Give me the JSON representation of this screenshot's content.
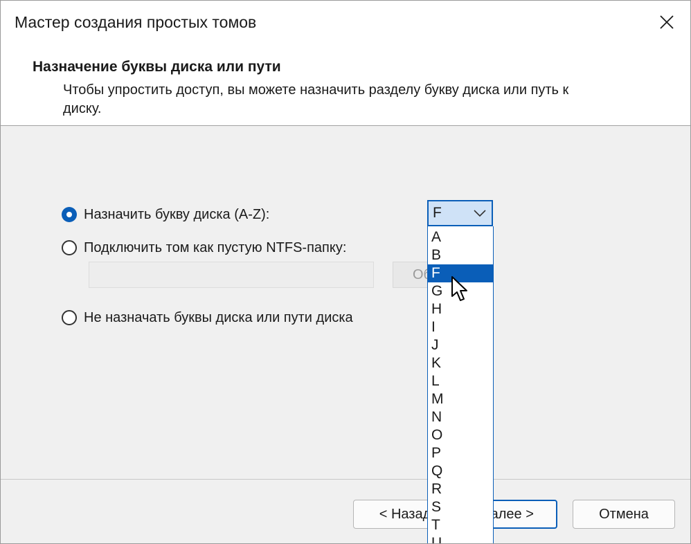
{
  "window": {
    "title": "Мастер создания простых томов"
  },
  "header": {
    "title": "Назначение буквы диска или пути",
    "description": "Чтобы упростить доступ, вы можете назначить разделу букву диска или путь к диску."
  },
  "options": {
    "assign_letter": "Назначить букву диска (A-Z):",
    "mount_ntfs": "Подключить том как пустую NTFS-папку:",
    "no_assign": "Не назначать буквы диска или пути диска",
    "selected": "assign_letter"
  },
  "browse": {
    "label": "Об"
  },
  "combo": {
    "value": "F"
  },
  "dropdown": {
    "items": [
      "A",
      "B",
      "F",
      "G",
      "H",
      "I",
      "J",
      "K",
      "L",
      "M",
      "N",
      "O",
      "P",
      "Q",
      "R",
      "S",
      "T",
      "U"
    ],
    "selected": "F"
  },
  "buttons": {
    "back": "< Назад",
    "next": "Далее >",
    "cancel": "Отмена"
  },
  "colors": {
    "accent": "#0a5eb8",
    "combo_bg": "#cfe2f7"
  },
  "icons": {
    "close": "close-icon",
    "combo_arrow": "chevron-down-icon",
    "cursor": "mouse-pointer-icon"
  }
}
